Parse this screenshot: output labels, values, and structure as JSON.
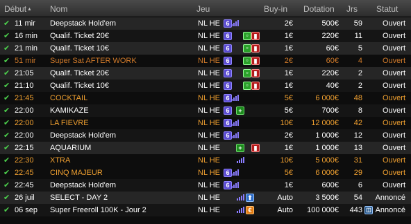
{
  "headers": {
    "debut": "Début",
    "nom": "Nom",
    "jeu": "Jeu",
    "buyin": "Buy-in",
    "dotation": "Dotation",
    "jrs": "Jrs",
    "statut": "Statut"
  },
  "colors": {
    "highlight_text": "#f0a030",
    "late_text": "#d07a2a",
    "check": "#4dd14d"
  },
  "rows": [
    {
      "time": "11 mir",
      "name": "Deepstack Hold'em",
      "game": "NL HE",
      "icons": [
        "six",
        "bars"
      ],
      "buyin": "2€",
      "dotation": "500€",
      "jrs": "59",
      "status": "Ouvert",
      "style": "alt"
    },
    {
      "time": "16 min",
      "name": "Qualif. Ticket 20€",
      "game": "NL HE",
      "icons": [
        "six",
        "green",
        "ticket"
      ],
      "buyin": "1€",
      "dotation": "220€",
      "jrs": "11",
      "status": "Ouvert",
      "style": "base"
    },
    {
      "time": "21 min",
      "name": "Qualif. Ticket 10€",
      "game": "NL HE",
      "icons": [
        "six",
        "green",
        "ticket"
      ],
      "buyin": "1€",
      "dotation": "60€",
      "jrs": "5",
      "status": "Ouvert",
      "style": "alt"
    },
    {
      "time": "51 mir",
      "name": "Super Sat AFTER WORK",
      "game": "NL HE",
      "icons": [
        "six",
        "green",
        "ticket"
      ],
      "buyin": "2€",
      "dotation": "60€",
      "jrs": "4",
      "status": "Ouvert",
      "style": "late"
    },
    {
      "time": "21:05",
      "name": "Qualif. Ticket 20€",
      "game": "NL HE",
      "icons": [
        "six",
        "green",
        "ticket"
      ],
      "buyin": "1€",
      "dotation": "220€",
      "jrs": "2",
      "status": "Ouvert",
      "style": "alt"
    },
    {
      "time": "21:10",
      "name": "Qualif. Ticket 10€",
      "game": "NL HE",
      "icons": [
        "six",
        "green",
        "ticket"
      ],
      "buyin": "1€",
      "dotation": "40€",
      "jrs": "2",
      "status": "Ouvert",
      "style": "base"
    },
    {
      "time": "21:45",
      "name": "COCKTAIL",
      "game": "NL HE",
      "icons": [
        "six",
        "bars"
      ],
      "buyin": "5€",
      "dotation": "6 000€",
      "jrs": "48",
      "status": "Ouvert",
      "style": "hl"
    },
    {
      "time": "22:00",
      "name": "KAMIKAZE",
      "game": "NL HE",
      "icons": [
        "six",
        "plus"
      ],
      "buyin": "5€",
      "dotation": "700€",
      "jrs": "8",
      "status": "Ouvert",
      "style": "base"
    },
    {
      "time": "22:00",
      "name": "LA FIEVRE",
      "game": "NL HE",
      "icons": [
        "six",
        "bars"
      ],
      "buyin": "10€",
      "dotation": "12 000€",
      "jrs": "42",
      "status": "Ouvert",
      "style": "hl"
    },
    {
      "time": "22:00",
      "name": "Deepstack Hold'em",
      "game": "NL HE",
      "icons": [
        "six",
        "bars"
      ],
      "buyin": "2€",
      "dotation": "1 000€",
      "jrs": "12",
      "status": "Ouvert",
      "style": "base"
    },
    {
      "time": "22:15",
      "name": "AQUARIUM",
      "game": "NL HE",
      "icons": [
        "plus",
        "ticket"
      ],
      "buyin": "1€",
      "dotation": "1 000€",
      "jrs": "13",
      "status": "Ouvert",
      "style": "alt"
    },
    {
      "time": "22:30",
      "name": "XTRA",
      "game": "NL HE",
      "icons": [
        "bars"
      ],
      "buyin": "10€",
      "dotation": "5 000€",
      "jrs": "31",
      "status": "Ouvert",
      "style": "hl"
    },
    {
      "time": "22:45",
      "name": "CINQ MAJEUR",
      "game": "NL HE",
      "icons": [
        "six",
        "bars"
      ],
      "buyin": "5€",
      "dotation": "6 000€",
      "jrs": "29",
      "status": "Ouvert",
      "style": "hl"
    },
    {
      "time": "22:45",
      "name": "Deepstack Hold'em",
      "game": "NL HE",
      "icons": [
        "six",
        "bars"
      ],
      "buyin": "1€",
      "dotation": "600€",
      "jrs": "6",
      "status": "Ouvert",
      "style": "base"
    },
    {
      "time": "26 juil",
      "name": "SELECT - DAY 2",
      "game": "NL HE",
      "icons": [
        "bars",
        "blue"
      ],
      "buyin": "Auto",
      "dotation": "3 500€",
      "jrs": "54",
      "status": "Annoncé",
      "style": "alt"
    },
    {
      "time": "06 sep",
      "name": "Super Freeroll 100K - Jour 2",
      "game": "NL HE",
      "icons": [
        "bars",
        "orange"
      ],
      "buyin": "Auto",
      "dotation": "100 000€",
      "jrs": "443",
      "status": "Annoncé",
      "style": "base",
      "status_icon": "cal"
    }
  ]
}
